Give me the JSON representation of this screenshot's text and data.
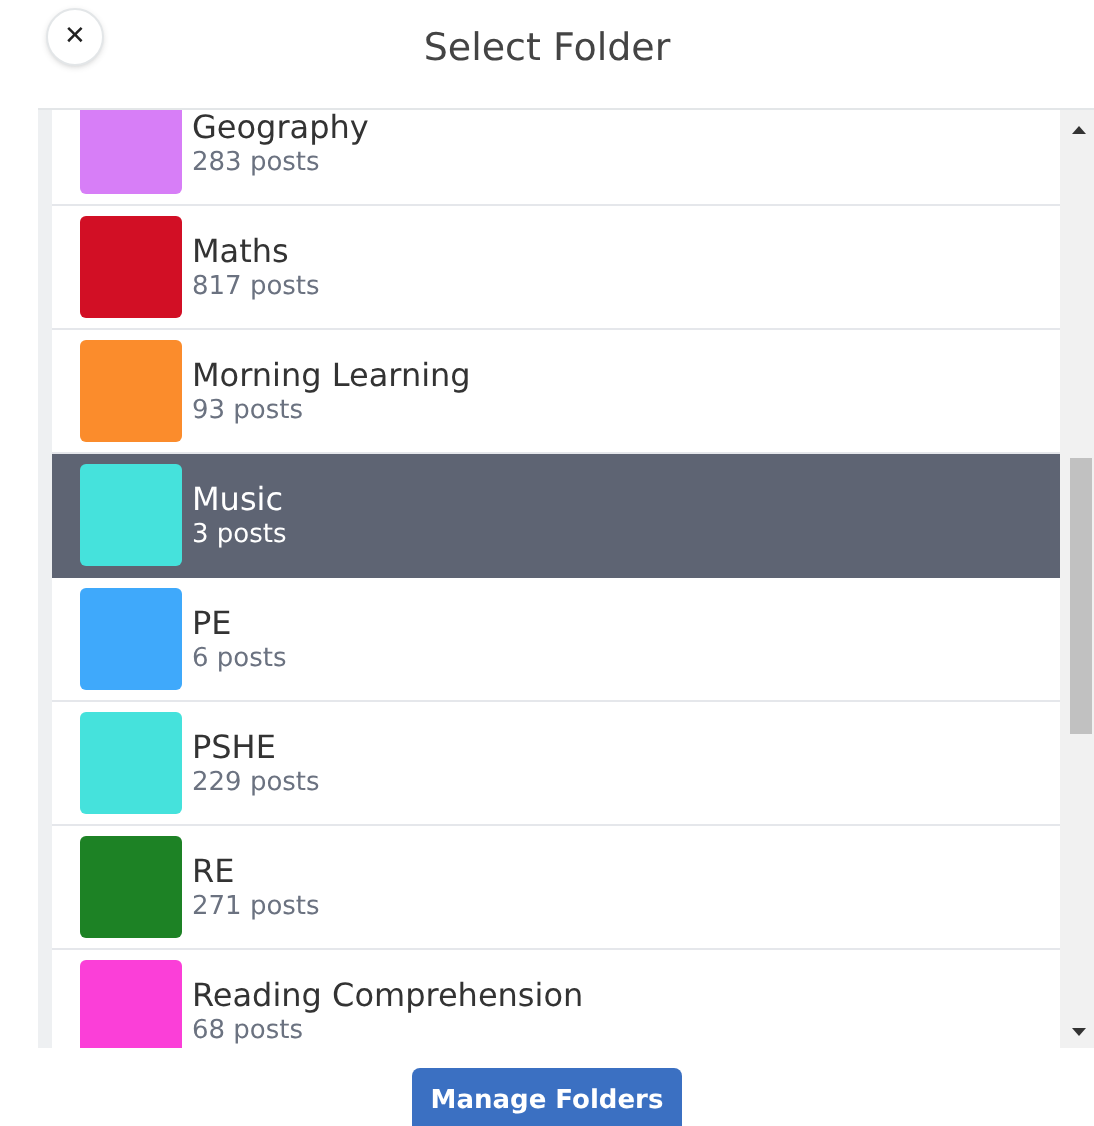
{
  "header": {
    "close": "✕",
    "title": "Select Folder"
  },
  "folders": [
    {
      "name": "Geography",
      "count": "283 posts",
      "color": "#d77ef7",
      "selected": false
    },
    {
      "name": "Maths",
      "count": "817 posts",
      "color": "#d20f25",
      "selected": false
    },
    {
      "name": "Morning Learning",
      "count": "93 posts",
      "color": "#fb8c2c",
      "selected": false
    },
    {
      "name": "Music",
      "count": "3 posts",
      "color": "#45e2dc",
      "selected": true
    },
    {
      "name": "PE",
      "count": "6 posts",
      "color": "#3fa9fb",
      "selected": false
    },
    {
      "name": "PSHE",
      "count": "229 posts",
      "color": "#45e2dc",
      "selected": false
    },
    {
      "name": "RE",
      "count": "271 posts",
      "color": "#1d8225",
      "selected": false
    },
    {
      "name": "Reading Comprehension",
      "count": "68 posts",
      "color": "#fb3fd8",
      "selected": false
    }
  ],
  "footer": {
    "button": "Manage Folders"
  }
}
